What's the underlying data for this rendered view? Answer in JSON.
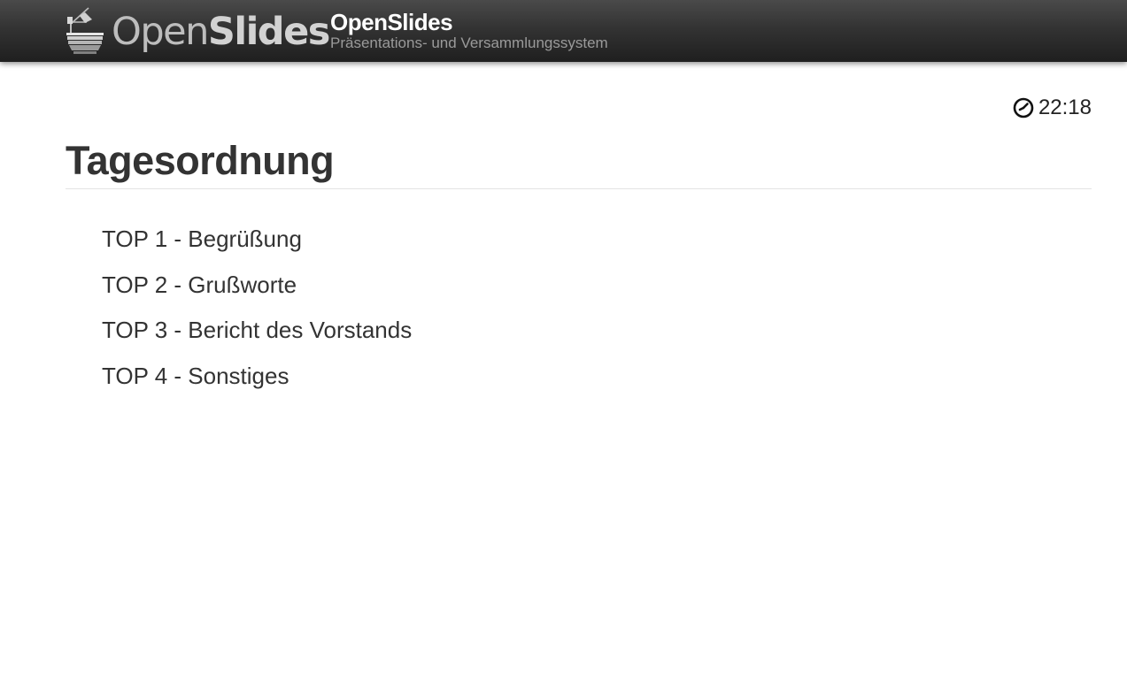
{
  "header": {
    "logo": {
      "text_light": "Open",
      "text_bold": "Slides",
      "icon": "projector-logo-icon"
    },
    "title": "OpenSlides",
    "subtitle": "Präsentations- und Versammlungssystem"
  },
  "clock": {
    "icon": "clock-icon",
    "time": "22:18"
  },
  "page": {
    "title": "Tagesordnung",
    "agenda_items": [
      "TOP 1 - Begrüßung",
      "TOP 2 - Grußworte",
      "TOP 3 - Bericht des Vorstands",
      "TOP 4 - Sonstiges"
    ]
  },
  "colors": {
    "header_top": "#4a4a4a",
    "header_bottom": "#1f1f1f",
    "header_title": "#ffffff",
    "header_subtitle": "#9a9a9a",
    "text": "#333333",
    "divider": "#e3e3e3"
  }
}
